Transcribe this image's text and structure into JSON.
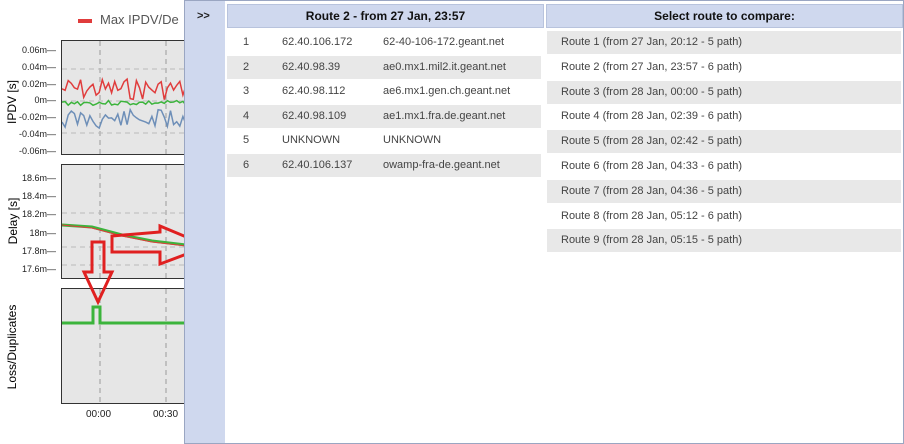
{
  "charts": {
    "legend_label": "Max IPDV/De",
    "legend_color": "#e03c3c",
    "ipdv": {
      "ylabel": "IPDV [s]",
      "ticks": [
        "0.06m",
        "0.04m",
        "0.02m",
        "0m",
        "-0.02m",
        "-0.04m",
        "-0.06m"
      ]
    },
    "delay": {
      "ylabel": "Delay [s]",
      "ticks": [
        "18.6m",
        "18.4m",
        "18.2m",
        "18m",
        "17.8m",
        "17.6m"
      ]
    },
    "loss": {
      "ylabel": "Loss/Duplicates"
    },
    "x_ticks": [
      "00:00",
      "00:30"
    ],
    "series_colors": {
      "max": "#e03c3c",
      "mid": "#3cb43c",
      "min": "#6e8fb8"
    }
  },
  "panel": {
    "toggle_label": ">>",
    "route_header": "Route 2 - from 27 Jan, 23:57",
    "compare_header": "Select route to compare:",
    "hops": [
      {
        "n": "1",
        "ip": "62.40.106.172",
        "host": "62-40-106-172.geant.net"
      },
      {
        "n": "2",
        "ip": "62.40.98.39",
        "host": "ae0.mx1.mil2.it.geant.net"
      },
      {
        "n": "3",
        "ip": "62.40.98.112",
        "host": "ae6.mx1.gen.ch.geant.net"
      },
      {
        "n": "4",
        "ip": "62.40.98.109",
        "host": "ae1.mx1.fra.de.geant.net"
      },
      {
        "n": "5",
        "ip": "UNKNOWN",
        "host": "UNKNOWN"
      },
      {
        "n": "6",
        "ip": "62.40.106.137",
        "host": "owamp-fra-de.geant.net"
      }
    ],
    "routes": [
      "Route 1 (from 27 Jan, 20:12 - 5 path)",
      "Route 2 (from 27 Jan, 23:57 - 6 path)",
      "Route 3 (from 28 Jan, 00:00 - 5 path)",
      "Route 4 (from 28 Jan, 02:39 - 6 path)",
      "Route 5 (from 28 Jan, 02:42 - 5 path)",
      "Route 6 (from 28 Jan, 04:33 - 6 path)",
      "Route 7 (from 28 Jan, 04:36 - 5 path)",
      "Route 8 (from 28 Jan, 05:12 - 6 path)",
      "Route 9 (from 28 Jan, 05:15 - 5 path)"
    ]
  },
  "annotation_color": "#e02020"
}
